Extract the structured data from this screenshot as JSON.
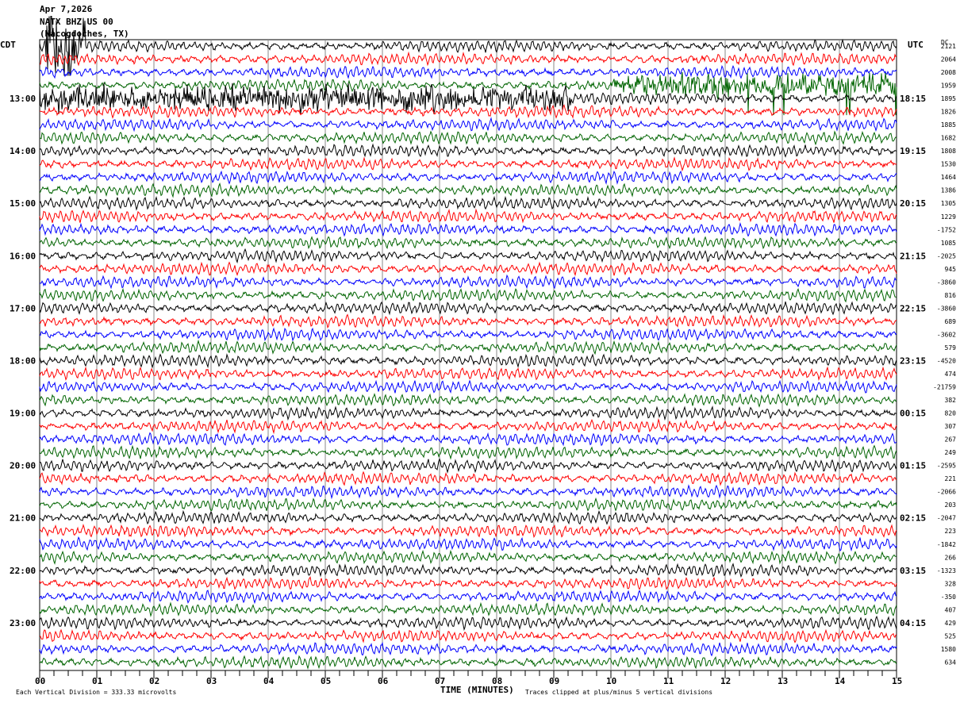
{
  "header": {
    "date": "Apr 7,2026",
    "station": "NATX BHZ US 00",
    "location": "(Nacogdoches, TX)"
  },
  "chart_data": {
    "type": "line",
    "title": "NATX BHZ US 00 helicorder",
    "xlabel": "TIME (MINUTES)",
    "xlim": [
      0,
      15
    ],
    "x_ticks": [
      "00",
      "01",
      "02",
      "03",
      "04",
      "05",
      "06",
      "07",
      "08",
      "09",
      "10",
      "11",
      "12",
      "13",
      "14",
      "15"
    ],
    "left_axis_title": "CDT",
    "right_axis_title": "UTC",
    "dc_title": "DC",
    "left_labels": [
      "13:00",
      "14:00",
      "15:00",
      "16:00",
      "17:00",
      "18:00",
      "19:00",
      "20:00",
      "21:00",
      "22:00",
      "23:00"
    ],
    "right_labels": [
      "18:15",
      "19:15",
      "20:15",
      "21:15",
      "22:15",
      "23:15",
      "00:15",
      "01:15",
      "02:15",
      "03:15",
      "04:15"
    ],
    "trace_colors": [
      "#000000",
      "#ff0000",
      "#0000ff",
      "#006400"
    ],
    "trace_count": 48,
    "dc_offsets": [
      "2121",
      "2064",
      "2008",
      "1959",
      "1895",
      "1826",
      "1885",
      "1682",
      "1808",
      "1530",
      "1464",
      "1386",
      "1305",
      "1229",
      "-1752",
      "1085",
      "-2025",
      "945",
      "-3860",
      "816",
      "-3860",
      "689",
      "-3602",
      "579",
      "-4520",
      "474",
      "-21759",
      "382",
      "820",
      "307",
      "267",
      "249",
      "-2595",
      "221",
      "-2066",
      "203",
      "-2047",
      "223",
      "-1842",
      "266",
      "-1323",
      "328",
      "-350",
      "407",
      "429",
      "525",
      "1580",
      "634"
    ],
    "events": [
      {
        "trace": 4,
        "from_min": 0,
        "to_min": 9.3,
        "amplitude_div": 1.6
      },
      {
        "trace": 3,
        "from_min": 10,
        "to_min": 15,
        "amplitude_div": 1.4
      },
      {
        "trace": 0,
        "from_min": 0.1,
        "to_min": 0.8,
        "amplitude_div": 5
      }
    ]
  },
  "footer": {
    "scale": "Each Vertical Division =  333.33 microvolts",
    "clip": "Traces clipped at plus/minus 5 vertical divisions",
    "xlabel": "TIME (MINUTES)"
  }
}
